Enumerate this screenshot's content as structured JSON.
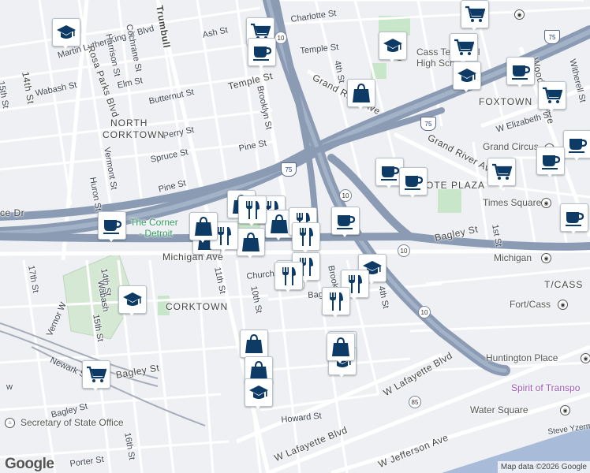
{
  "map": {
    "streets": {
      "mlk": "Martin Luther King Jr Blvd",
      "trumbull": "Trumbull",
      "ash": "Ash St",
      "charlotte": "Charlotte St",
      "temple_w": "Temple St",
      "temple_e": "Temple St",
      "cochrane": "Cochrane St",
      "harrison": "Harrison St",
      "rosa_parks": "Rosa Parks Blvd",
      "elm": "Elm St",
      "butternut": "Butternut St",
      "wabash": "Wabash St",
      "fourteenth_n": "14th St",
      "fifteenth_n": "15th St",
      "perry": "Perry St",
      "spruce": "Spruce St",
      "pine_w": "Pine St",
      "pine_e": "Pine St",
      "vermont": "Vermont St",
      "huron": "Huron St",
      "brooklyn": "Brooklyn St",
      "grand_river_w": "Grand River Ave",
      "grand_river_e": "Grand River Ave",
      "fourth": "4th St",
      "woodward": "Woodward Ave",
      "witherell": "Witherell St",
      "w_elizabeth": "W Elizabeth St",
      "first": "1st St",
      "michigan": "Michigan Ave",
      "church": "Church St",
      "tenth": "10th St",
      "eleventh": "11th St",
      "bagley_w": "Bagley St",
      "bagley_c": "Bagley St",
      "bagley_e": "Bagley St",
      "bagley_sw": "Bagley St",
      "seventeenth": "17th St",
      "fourteenth_s": "14th St",
      "fifteenth_s": "15th St",
      "sixteenth": "16th St",
      "vernor": "Vernor W",
      "newark": "Newark St",
      "w_lafayette_e": "W Lafayette Blvd",
      "w_lafayette_w": "W Lafayette Blvd",
      "w_jefferson": "W Jefferson Ave",
      "howard": "Howard St",
      "porter": "Porter St",
      "steve": "Steve Yzerma",
      "brooklyn_s": "Brooklyn St",
      "fourth_s": "4th St",
      "dr": "ce Dr",
      "w_edge": "w",
      "ce": "Church St"
    },
    "places": {
      "north_corktown_1": "NORTH",
      "north_corktown_2": "CORKTOWN",
      "corktown": "CORKTOWN",
      "foxtown": "FOXTOWN",
      "ote_plaza": "OTE PLAZA",
      "cass_cassan": "T/CASS",
      "corner_1": "The Corner",
      "corner_2": "- Detroit",
      "cass_tech_1": "Cass Technical",
      "cass_tech_2": "High School",
      "grand_circus": "Grand Circus",
      "times_square": "Times Square",
      "michigan_stn": "Michigan",
      "fort_cass": "Fort/Cass",
      "huntington": "Huntington Place",
      "spirit": "Spirit of Transpo",
      "water_square": "Water Square",
      "sos": "Secretary of State Office",
      "wabash_s": "Wabash"
    },
    "shields": {
      "i75_a": "75",
      "i75_b": "75",
      "i75_c": "75",
      "m10_a": "10",
      "m10_b": "10",
      "m10_c": "10",
      "m10_d": "10",
      "m85": "85"
    },
    "pins": [
      {
        "icon": "school-icon"
      },
      {
        "icon": "cart-icon"
      },
      {
        "icon": "coffee-icon"
      },
      {
        "icon": "school-icon"
      },
      {
        "icon": "cart-icon"
      },
      {
        "icon": "school-icon"
      },
      {
        "icon": "coffee-icon"
      },
      {
        "icon": "bag-icon"
      },
      {
        "icon": "cart-icon"
      },
      {
        "icon": "cart-icon"
      },
      {
        "icon": "coffee-icon"
      },
      {
        "icon": "coffee-icon"
      },
      {
        "icon": "cart-icon"
      },
      {
        "icon": "coffee-icon"
      },
      {
        "icon": "coffee-icon"
      },
      {
        "icon": "coffee-icon"
      },
      {
        "icon": "coffee-icon"
      },
      {
        "icon": "bag-icon"
      },
      {
        "icon": "fork-knife-icon"
      },
      {
        "icon": "bag-icon"
      },
      {
        "icon": "fork-knife-icon"
      },
      {
        "icon": "bag-icon"
      },
      {
        "icon": "fork-knife-icon"
      },
      {
        "icon": "bag-icon"
      },
      {
        "icon": "fork-knife-icon"
      },
      {
        "icon": "bag-icon"
      },
      {
        "icon": "fork-knife-icon"
      },
      {
        "icon": "bag-icon"
      },
      {
        "icon": "fork-knife-icon"
      },
      {
        "icon": "fork-knife-icon"
      },
      {
        "icon": "school-icon"
      },
      {
        "icon": "fork-knife-icon"
      },
      {
        "icon": "fork-knife-icon"
      },
      {
        "icon": "school-icon"
      },
      {
        "icon": "fork-knife-icon"
      },
      {
        "icon": "bag-icon"
      },
      {
        "icon": "bag-icon"
      },
      {
        "icon": "school-icon"
      },
      {
        "icon": "bag-icon"
      },
      {
        "icon": "school-icon"
      },
      {
        "icon": "cart-icon"
      },
      {
        "icon": "coffee-icon"
      }
    ],
    "logo": "Google",
    "attribution": "Map data ©2026 Google",
    "colors": {
      "pin_icon": "#0d3b66",
      "highway": "#8a9bb3",
      "water": "#a8bcd9",
      "park": "#c8e6c9"
    }
  }
}
